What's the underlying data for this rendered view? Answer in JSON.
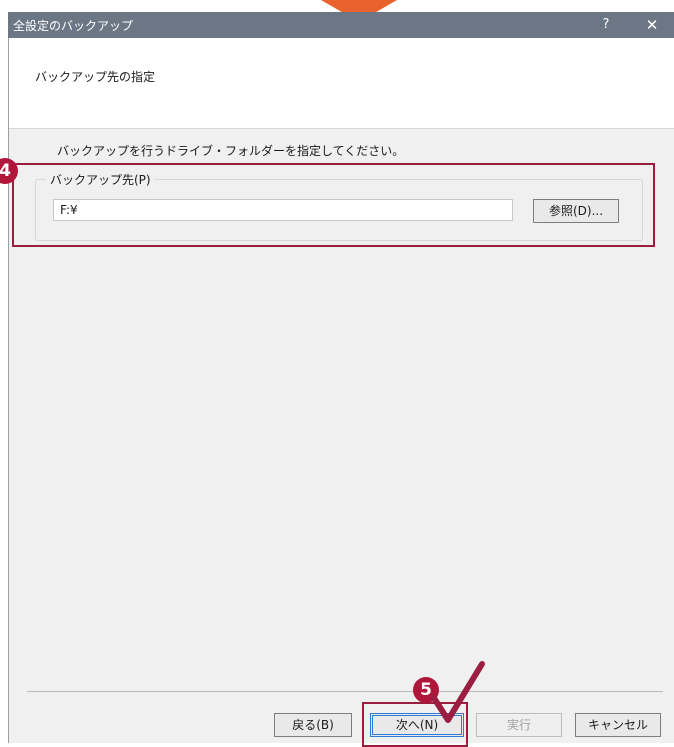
{
  "window": {
    "title": "全設定のバックアップ",
    "help_glyph": "?",
    "close_glyph": "✕"
  },
  "header": {
    "heading": "バックアップ先の指定"
  },
  "main": {
    "instruction": "バックアップを行うドライブ・フォルダーを指定してください。",
    "group_label": "バックアップ先(P)",
    "path_value": "F:¥",
    "browse_label": "参照(D)..."
  },
  "footer": {
    "back_label": "戻る(B)",
    "next_label": "次へ(N)",
    "run_label": "実行",
    "cancel_label": "キャンセル"
  },
  "annotations": {
    "step4": "4",
    "step5": "5",
    "highlight_color": "#9b1e40",
    "badge_color": "#b0163a",
    "arrow_color": "#e8622d"
  }
}
